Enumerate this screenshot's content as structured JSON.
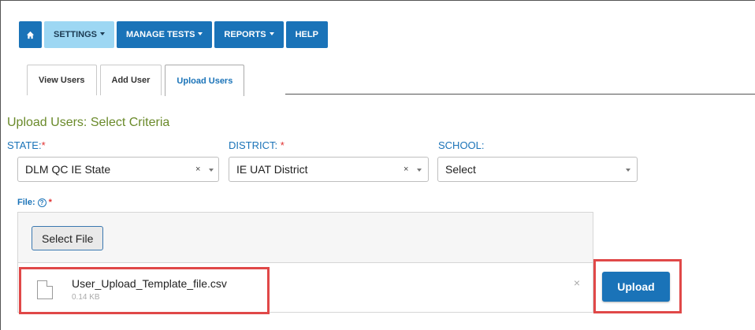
{
  "nav": {
    "home_icon": "home-icon",
    "items": [
      {
        "label": "SETTINGS",
        "has_caret": true,
        "active": true
      },
      {
        "label": "MANAGE TESTS",
        "has_caret": true,
        "active": false
      },
      {
        "label": "REPORTS",
        "has_caret": true,
        "active": false
      },
      {
        "label": "HELP",
        "has_caret": false,
        "active": false
      }
    ]
  },
  "tabs": [
    {
      "label": "View Users",
      "active": false
    },
    {
      "label": "Add User",
      "active": false
    },
    {
      "label": "Upload Users",
      "active": true
    }
  ],
  "section_title": "Upload Users: Select Criteria",
  "filters": {
    "state": {
      "label": "STATE:",
      "required_mark": "*",
      "value": "DLM QC IE State",
      "clear": "×"
    },
    "district": {
      "label": "DISTRICT:",
      "required_mark": "*",
      "value": "IE UAT District",
      "clear": "×"
    },
    "school": {
      "label": "SCHOOL:",
      "value": "Select"
    }
  },
  "file": {
    "label": "File:",
    "help_glyph": "?",
    "required_mark": "*",
    "select_button": "Select File",
    "selected_file_name": "User_Upload_Template_file.csv",
    "selected_file_size": "0.14 KB",
    "remove_glyph": "×"
  },
  "upload_button": "Upload",
  "colors": {
    "primary": "#1a73b8",
    "active_nav": "#9dd7f3",
    "title_green": "#6a8a2a",
    "highlight": "#e04848",
    "required": "#e03030"
  }
}
